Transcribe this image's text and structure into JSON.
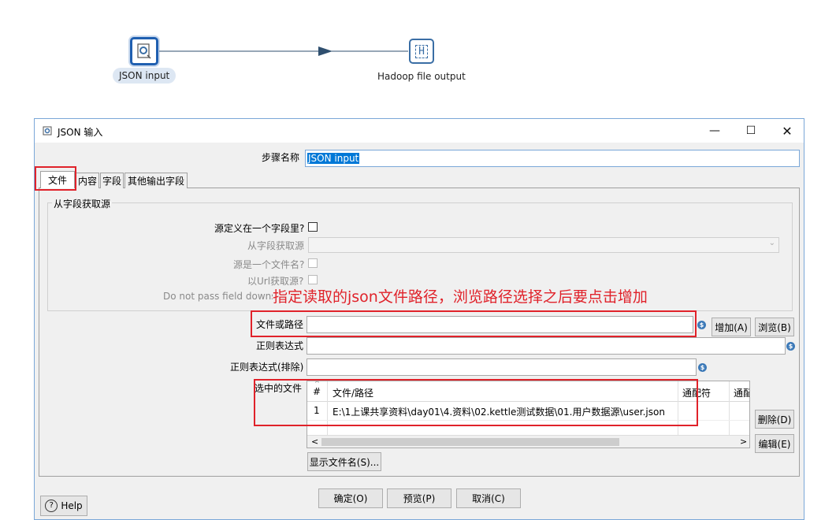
{
  "canvas": {
    "node1_label": "JSON input",
    "node2_label": "Hadoop file output",
    "node2_icon_letter": "H"
  },
  "dialog": {
    "title": "JSON 输入",
    "step_name_label": "步骤名称",
    "step_name_value": "JSON input",
    "tabs": [
      "文件",
      "内容",
      "字段",
      "其他输出字段"
    ],
    "group_title": "从字段获取源",
    "source_in_field_label": "源定义在一个字段里?",
    "get_from_field_label": "从字段获取源",
    "source_is_filename_label": "源是一个文件名?",
    "read_from_url_label": "以Url获取源?",
    "do_not_pass_label": "Do not pass field downs",
    "annotation": "指定读取的json文件路径，浏览路径选择之后要点击增加",
    "file_path_label": "文件或路径",
    "regex_label": "正则表达式",
    "regex_exclude_label": "正则表达式(排除)",
    "selected_files_label": "选中的文件",
    "add_button": "增加(A)",
    "browse_button": "浏览(B)",
    "delete_button": "删除(D)",
    "edit_button": "编辑(E)",
    "show_filenames_button": "显示文件名(S)...",
    "table": {
      "headers": [
        "#",
        "文件/路径",
        "通配符",
        "通配"
      ],
      "rows": [
        {
          "num": "1",
          "path": "E:\\1上课共享资料\\day01\\4.资料\\02.kettle测试数据\\01.用户数据源\\user.json"
        }
      ]
    },
    "var_icon": "$",
    "ok_button": "确定(O)",
    "preview_button": "预览(P)",
    "cancel_button": "取消(C)",
    "help_button": "Help"
  },
  "colors": {
    "accent": "#3a6ea5",
    "annotation": "#e0222a",
    "selection": "#0078d7"
  }
}
